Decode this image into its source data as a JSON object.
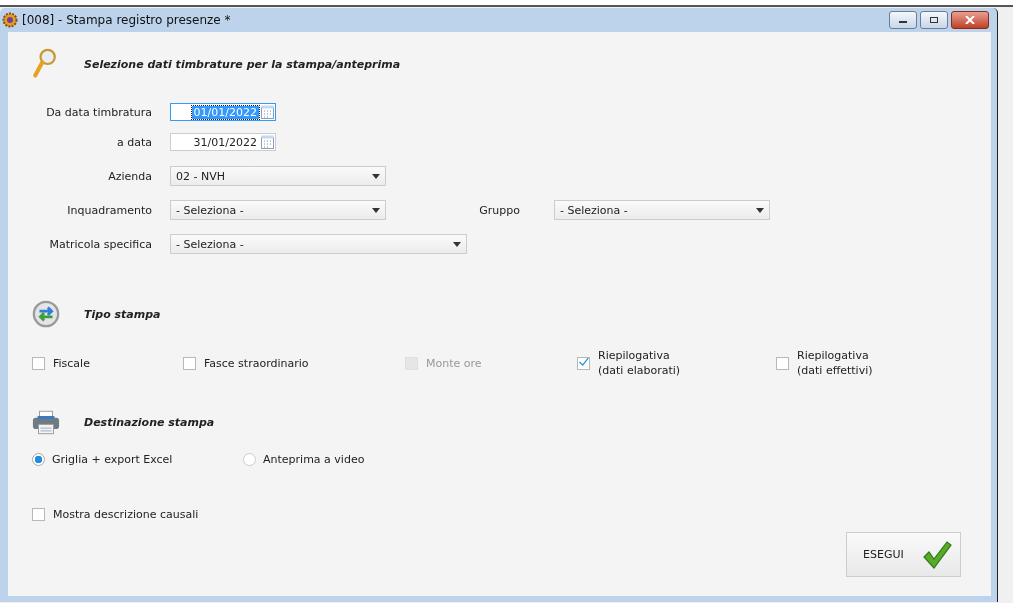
{
  "window": {
    "title": "[008] - Stampa registro presenze *"
  },
  "selection": {
    "title": "Selezione dati timbrature per la stampa/anteprima",
    "rows": [
      [
        {
          "kind": "date",
          "label": "Da data timbratura",
          "value": "01/01/2022",
          "focused": true
        }
      ],
      [
        {
          "kind": "date",
          "label": "a data",
          "value": "31/01/2022",
          "focused": false
        }
      ],
      [
        {
          "kind": "select",
          "label": "Azienda",
          "value": "02 - NVH"
        }
      ],
      [
        {
          "kind": "select",
          "label": "Inquadramento",
          "value": "- Seleziona -"
        },
        {
          "kind": "select",
          "label": "Gruppo",
          "value": "- Seleziona -"
        }
      ],
      [
        {
          "kind": "select-wide",
          "label": "Matricola specifica",
          "value": "- Seleziona -"
        }
      ]
    ]
  },
  "print_type": {
    "title": "Tipo stampa",
    "options": [
      {
        "label": "Fiscale",
        "checked": false,
        "disabled": false
      },
      {
        "label": "Fasce straordinario",
        "checked": false,
        "disabled": false
      },
      {
        "label": "Monte ore",
        "checked": false,
        "disabled": true
      },
      {
        "label": "Riepilogativa\n(dati elaborati)",
        "checked": true,
        "disabled": false
      },
      {
        "label": "Riepilogativa\n(dati effettivi)",
        "checked": false,
        "disabled": false
      }
    ]
  },
  "destination": {
    "title": "Destinazione stampa",
    "options": [
      {
        "label": "Griglia + export Excel",
        "selected": true
      },
      {
        "label": "Anteprima a video",
        "selected": false
      }
    ]
  },
  "show_descriptions": {
    "label": "Mostra descrizione causali",
    "checked": false
  },
  "run_button": {
    "label": "ESEGUI"
  }
}
